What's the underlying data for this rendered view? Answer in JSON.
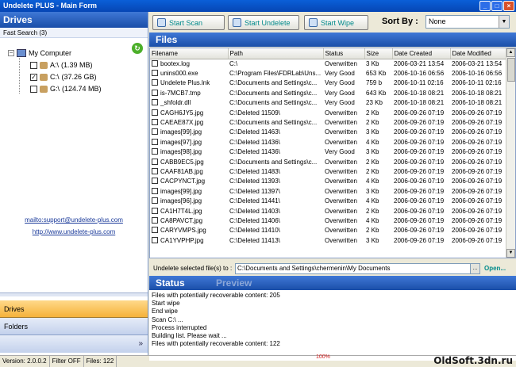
{
  "window": {
    "title": "Undelete PLUS - Main Form",
    "min": "_",
    "max": "□",
    "close": "×"
  },
  "drives_panel": {
    "title": "Drives",
    "fast_search": "Fast Search (3)",
    "root": "My Computer",
    "drives": [
      {
        "label": "A:\\",
        "size": "(1.39 MB)",
        "checked": false
      },
      {
        "label": "C:\\",
        "size": "(37.26 GB)",
        "checked": true
      },
      {
        "label": "G:\\",
        "size": "(124.74 MB)",
        "checked": false
      }
    ],
    "email_link": "mailto:support@undelete-plus.com",
    "web_link": "http://www.undelete-plus.com"
  },
  "nav": {
    "drives": "Drives",
    "folders": "Folders",
    "more": "»"
  },
  "toolbar": {
    "start_scan": "Start Scan",
    "start_undelete": "Start Undelete",
    "start_wipe": "Start Wipe",
    "sort_by_label": "Sort By :",
    "sort_by_value": "None"
  },
  "files": {
    "title": "Files",
    "columns": [
      "Filename",
      "Path",
      "Status",
      "Size",
      "Date Created",
      "Date Modified"
    ],
    "rows": [
      [
        "bootex.log",
        "C:\\",
        "Overwritten",
        "3 Kb",
        "2006-03-21 13:54",
        "2006-03-21 13:54"
      ],
      [
        "unins000.exe",
        "C:\\Program Files\\FDRLab\\Uns...",
        "Very Good",
        "653 Kb",
        "2006-10-16 06:56",
        "2006-10-16 06:56"
      ],
      [
        "Undelete Plus.lnk",
        "C:\\Documents and Settings\\c...",
        "Very Good",
        "759 b",
        "2006-10-11 02:16",
        "2006-10-11 02:16"
      ],
      [
        "is-7MCB7.tmp",
        "C:\\Documents and Settings\\c...",
        "Very Good",
        "643 Kb",
        "2006-10-18 08:21",
        "2006-10-18 08:21"
      ],
      [
        "_shfoldr.dll",
        "C:\\Documents and Settings\\c...",
        "Very Good",
        "23 Kb",
        "2006-10-18 08:21",
        "2006-10-18 08:21"
      ],
      [
        "CAGH6JY5.jpg",
        "C:\\Deleted 11509\\",
        "Overwritten",
        "2 Kb",
        "2006-09-26 07:19",
        "2006-09-26 07:19"
      ],
      [
        "CAEAE87X.jpg",
        "C:\\Documents and Settings\\c...",
        "Overwritten",
        "2 Kb",
        "2006-09-26 07:19",
        "2006-09-26 07:19"
      ],
      [
        "images[99].jpg",
        "C:\\Deleted 11463\\",
        "Overwritten",
        "3 Kb",
        "2006-09-26 07:19",
        "2006-09-26 07:19"
      ],
      [
        "images[97].jpg",
        "C:\\Deleted 11436\\",
        "Overwritten",
        "4 Kb",
        "2006-09-26 07:19",
        "2006-09-26 07:19"
      ],
      [
        "images[98].jpg",
        "C:\\Deleted 11436\\",
        "Very Good",
        "3 Kb",
        "2006-09-26 07:19",
        "2006-09-26 07:19"
      ],
      [
        "CABB9EC5.jpg",
        "C:\\Documents and Settings\\c...",
        "Overwritten",
        "2 Kb",
        "2006-09-26 07:19",
        "2006-09-26 07:19"
      ],
      [
        "CAAF81AB.jpg",
        "C:\\Deleted 11483\\",
        "Overwritten",
        "2 Kb",
        "2006-09-26 07:19",
        "2006-09-26 07:19"
      ],
      [
        "CACPYNCT.jpg",
        "C:\\Deleted 11393\\",
        "Overwritten",
        "4 Kb",
        "2006-09-26 07:19",
        "2006-09-26 07:19"
      ],
      [
        "images[99].jpg",
        "C:\\Deleted 11397\\",
        "Overwritten",
        "3 Kb",
        "2006-09-26 07:19",
        "2006-09-26 07:19"
      ],
      [
        "images[96].jpg",
        "C:\\Deleted 11441\\",
        "Overwritten",
        "4 Kb",
        "2006-09-26 07:19",
        "2006-09-26 07:19"
      ],
      [
        "CA1H7T4L.jpg",
        "C:\\Deleted 11403\\",
        "Overwritten",
        "2 Kb",
        "2006-09-26 07:19",
        "2006-09-26 07:19"
      ],
      [
        "CA8PAVCT.jpg",
        "C:\\Deleted 11406\\",
        "Overwritten",
        "4 Kb",
        "2006-09-26 07:19",
        "2006-09-26 07:19"
      ],
      [
        "CARYVMPS.jpg",
        "C:\\Deleted 11410\\",
        "Overwritten",
        "2 Kb",
        "2006-09-26 07:19",
        "2006-09-26 07:19"
      ],
      [
        "CA1YVPHP.jpg",
        "C:\\Deleted 11413\\",
        "Overwritten",
        "3 Kb",
        "2006-09-26 07:19",
        "2006-09-26 07:19"
      ]
    ]
  },
  "destination": {
    "label": "Undelete selected file(s) to :",
    "value": "C:\\Documents and Settings\\chermenin\\My Documents",
    "browse": "...",
    "open": "Open..."
  },
  "status_panel": {
    "tab_status": "Status",
    "tab_preview": "Preview",
    "log": [
      "Files with potentially recoverable content: 205",
      "Start wipe",
      "End wipe",
      "Scan C:\\ ...",
      "Process interrupted",
      "Building list. Please wait ...",
      "Files with potentially recoverable content: 122"
    ],
    "progress_text": "100%"
  },
  "statusbar": {
    "version": "Version: 2.0.0.2",
    "filter": "Filter OFF",
    "files": "Files: 122"
  },
  "watermark": "OldSoft.3dn.ru"
}
